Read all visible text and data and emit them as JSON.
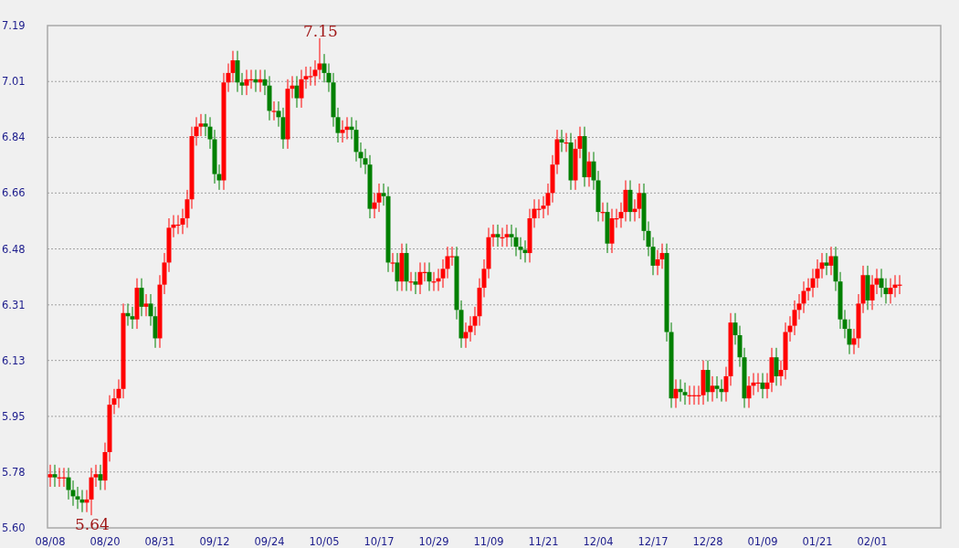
{
  "chart": {
    "chart_data": {
      "type": "candlestick",
      "grid": true,
      "ylim": [
        5.6,
        7.19
      ],
      "yticks": [
        {
          "value": 5.6,
          "label": "5.60"
        },
        {
          "value": 5.777,
          "label": "5.78"
        },
        {
          "value": 5.953,
          "label": "5.95"
        },
        {
          "value": 6.13,
          "label": "6.13"
        },
        {
          "value": 6.306,
          "label": "6.31"
        },
        {
          "value": 6.483,
          "label": "6.48"
        },
        {
          "value": 6.66,
          "label": "6.66"
        },
        {
          "value": 6.836,
          "label": "6.84"
        },
        {
          "value": 7.013,
          "label": "7.01"
        },
        {
          "value": 7.19,
          "label": "7.19"
        }
      ],
      "categories": [
        "08/08",
        null,
        null,
        null,
        null,
        null,
        null,
        null,
        null,
        null,
        null,
        null,
        "08/20",
        null,
        null,
        null,
        null,
        null,
        null,
        null,
        null,
        null,
        null,
        null,
        "08/31",
        null,
        null,
        null,
        null,
        null,
        null,
        null,
        null,
        null,
        null,
        null,
        "09/12",
        null,
        null,
        null,
        null,
        null,
        null,
        null,
        null,
        null,
        null,
        null,
        "09/24",
        null,
        null,
        null,
        null,
        null,
        null,
        null,
        null,
        null,
        null,
        null,
        "10/05",
        null,
        null,
        null,
        null,
        null,
        null,
        null,
        null,
        null,
        null,
        null,
        "10/17",
        null,
        null,
        null,
        null,
        null,
        null,
        null,
        null,
        null,
        null,
        null,
        "10/29",
        null,
        null,
        null,
        null,
        null,
        null,
        null,
        null,
        null,
        null,
        null,
        "11/09",
        null,
        null,
        null,
        null,
        null,
        null,
        null,
        null,
        null,
        null,
        null,
        "11/21",
        null,
        null,
        null,
        null,
        null,
        null,
        null,
        null,
        null,
        null,
        null,
        "12/04",
        null,
        null,
        null,
        null,
        null,
        null,
        null,
        null,
        null,
        null,
        null,
        "12/17",
        null,
        null,
        null,
        null,
        null,
        null,
        null,
        null,
        null,
        null,
        null,
        "12/28",
        null,
        null,
        null,
        null,
        null,
        null,
        null,
        null,
        null,
        null,
        null,
        "01/09",
        null,
        null,
        null,
        null,
        null,
        null,
        null,
        null,
        null,
        null,
        null,
        "01/21",
        null,
        null,
        null,
        null,
        null,
        null,
        null,
        null,
        null,
        null,
        null,
        "02/01",
        null,
        null,
        null,
        null,
        null,
        null
      ],
      "ohlc": [
        [
          5.76,
          5.8,
          5.73,
          5.77
        ],
        [
          5.77,
          5.8,
          5.73,
          5.76
        ],
        [
          5.76,
          5.79,
          5.73,
          5.76
        ],
        [
          5.76,
          5.79,
          5.73,
          5.76
        ],
        [
          5.76,
          5.79,
          5.69,
          5.72
        ],
        [
          5.72,
          5.75,
          5.67,
          5.7
        ],
        [
          5.7,
          5.73,
          5.66,
          5.69
        ],
        [
          5.69,
          5.72,
          5.65,
          5.68
        ],
        [
          5.68,
          5.72,
          5.65,
          5.69
        ],
        [
          5.69,
          5.79,
          5.64,
          5.76
        ],
        [
          5.76,
          5.8,
          5.73,
          5.77
        ],
        [
          5.77,
          5.8,
          5.72,
          5.75
        ],
        [
          5.75,
          5.87,
          5.72,
          5.84
        ],
        [
          5.84,
          6.02,
          5.81,
          5.99
        ],
        [
          5.99,
          6.04,
          5.96,
          6.01
        ],
        [
          6.01,
          6.07,
          5.98,
          6.04
        ],
        [
          6.04,
          6.31,
          6.01,
          6.28
        ],
        [
          6.28,
          6.31,
          6.24,
          6.27
        ],
        [
          6.27,
          6.3,
          6.23,
          6.26
        ],
        [
          6.26,
          6.39,
          6.23,
          6.36
        ],
        [
          6.36,
          6.39,
          6.27,
          6.3
        ],
        [
          6.3,
          6.34,
          6.27,
          6.31
        ],
        [
          6.31,
          6.34,
          6.24,
          6.27
        ],
        [
          6.27,
          6.3,
          6.17,
          6.2
        ],
        [
          6.2,
          6.4,
          6.17,
          6.37
        ],
        [
          6.37,
          6.47,
          6.34,
          6.44
        ],
        [
          6.44,
          6.58,
          6.41,
          6.55
        ],
        [
          6.55,
          6.59,
          6.52,
          6.56
        ],
        [
          6.56,
          6.59,
          6.53,
          6.56
        ],
        [
          6.56,
          6.61,
          6.53,
          6.58
        ],
        [
          6.58,
          6.67,
          6.55,
          6.64
        ],
        [
          6.64,
          6.87,
          6.61,
          6.84
        ],
        [
          6.84,
          6.9,
          6.81,
          6.87
        ],
        [
          6.87,
          6.91,
          6.84,
          6.88
        ],
        [
          6.88,
          6.91,
          6.84,
          6.87
        ],
        [
          6.87,
          6.9,
          6.8,
          6.83
        ],
        [
          6.83,
          6.86,
          6.69,
          6.72
        ],
        [
          6.72,
          6.75,
          6.67,
          6.7
        ],
        [
          6.7,
          7.04,
          6.67,
          7.01
        ],
        [
          7.01,
          7.07,
          6.98,
          7.04
        ],
        [
          7.04,
          7.11,
          7.01,
          7.08
        ],
        [
          7.08,
          7.11,
          6.98,
          7.01
        ],
        [
          7.01,
          7.04,
          6.97,
          7.0
        ],
        [
          7.0,
          7.05,
          6.97,
          7.02
        ],
        [
          7.02,
          7.05,
          6.99,
          7.02
        ],
        [
          7.02,
          7.05,
          6.98,
          7.01
        ],
        [
          7.01,
          7.05,
          6.98,
          7.02
        ],
        [
          7.02,
          7.05,
          6.97,
          7.0
        ],
        [
          7.0,
          7.03,
          6.89,
          6.92
        ],
        [
          6.92,
          6.95,
          6.89,
          6.92
        ],
        [
          6.92,
          6.95,
          6.87,
          6.9
        ],
        [
          6.9,
          6.93,
          6.8,
          6.83
        ],
        [
          6.83,
          7.02,
          6.8,
          6.99
        ],
        [
          6.99,
          7.03,
          6.96,
          7.0
        ],
        [
          7.0,
          7.03,
          6.93,
          6.96
        ],
        [
          6.96,
          7.05,
          6.93,
          7.02
        ],
        [
          7.02,
          7.06,
          6.99,
          7.03
        ],
        [
          7.03,
          7.06,
          7.0,
          7.03
        ],
        [
          7.03,
          7.08,
          7.0,
          7.05
        ],
        [
          7.05,
          7.15,
          7.02,
          7.07
        ],
        [
          7.07,
          7.1,
          7.01,
          7.04
        ],
        [
          7.04,
          7.07,
          6.98,
          7.01
        ],
        [
          7.01,
          7.04,
          6.87,
          6.9
        ],
        [
          6.9,
          6.93,
          6.82,
          6.85
        ],
        [
          6.85,
          6.89,
          6.82,
          6.86
        ],
        [
          6.86,
          6.9,
          6.83,
          6.87
        ],
        [
          6.87,
          6.9,
          6.83,
          6.86
        ],
        [
          6.86,
          6.89,
          6.76,
          6.79
        ],
        [
          6.79,
          6.82,
          6.74,
          6.77
        ],
        [
          6.77,
          6.8,
          6.72,
          6.75
        ],
        [
          6.75,
          6.78,
          6.58,
          6.61
        ],
        [
          6.61,
          6.66,
          6.58,
          6.63
        ],
        [
          6.63,
          6.69,
          6.6,
          6.66
        ],
        [
          6.66,
          6.69,
          6.62,
          6.65
        ],
        [
          6.65,
          6.68,
          6.41,
          6.44
        ],
        [
          6.44,
          6.47,
          6.41,
          6.44
        ],
        [
          6.44,
          6.47,
          6.35,
          6.38
        ],
        [
          6.38,
          6.5,
          6.35,
          6.47
        ],
        [
          6.47,
          6.5,
          6.35,
          6.38
        ],
        [
          6.38,
          6.41,
          6.35,
          6.38
        ],
        [
          6.38,
          6.41,
          6.34,
          6.37
        ],
        [
          6.37,
          6.44,
          6.34,
          6.41
        ],
        [
          6.41,
          6.44,
          6.38,
          6.41
        ],
        [
          6.41,
          6.44,
          6.35,
          6.38
        ],
        [
          6.38,
          6.41,
          6.35,
          6.38
        ],
        [
          6.38,
          6.42,
          6.35,
          6.39
        ],
        [
          6.39,
          6.45,
          6.36,
          6.42
        ],
        [
          6.42,
          6.49,
          6.39,
          6.46
        ],
        [
          6.46,
          6.49,
          6.43,
          6.46
        ],
        [
          6.46,
          6.49,
          6.26,
          6.29
        ],
        [
          6.29,
          6.32,
          6.17,
          6.2
        ],
        [
          6.2,
          6.25,
          6.17,
          6.22
        ],
        [
          6.22,
          6.27,
          6.19,
          6.24
        ],
        [
          6.24,
          6.3,
          6.21,
          6.27
        ],
        [
          6.27,
          6.39,
          6.24,
          6.36
        ],
        [
          6.36,
          6.45,
          6.33,
          6.42
        ],
        [
          6.42,
          6.55,
          6.39,
          6.52
        ],
        [
          6.52,
          6.56,
          6.49,
          6.53
        ],
        [
          6.53,
          6.56,
          6.49,
          6.52
        ],
        [
          6.52,
          6.55,
          6.49,
          6.52
        ],
        [
          6.52,
          6.56,
          6.49,
          6.53
        ],
        [
          6.53,
          6.56,
          6.49,
          6.52
        ],
        [
          6.52,
          6.55,
          6.46,
          6.49
        ],
        [
          6.49,
          6.52,
          6.45,
          6.48
        ],
        [
          6.48,
          6.51,
          6.44,
          6.47
        ],
        [
          6.47,
          6.61,
          6.44,
          6.58
        ],
        [
          6.58,
          6.64,
          6.55,
          6.61
        ],
        [
          6.61,
          6.64,
          6.58,
          6.61
        ],
        [
          6.61,
          6.65,
          6.58,
          6.62
        ],
        [
          6.62,
          6.69,
          6.59,
          6.66
        ],
        [
          6.66,
          6.78,
          6.63,
          6.75
        ],
        [
          6.75,
          6.86,
          6.72,
          6.83
        ],
        [
          6.83,
          6.86,
          6.79,
          6.82
        ],
        [
          6.82,
          6.85,
          6.79,
          6.82
        ],
        [
          6.82,
          6.85,
          6.67,
          6.7
        ],
        [
          6.7,
          6.83,
          6.67,
          6.8
        ],
        [
          6.8,
          6.87,
          6.77,
          6.84
        ],
        [
          6.84,
          6.87,
          6.68,
          6.71
        ],
        [
          6.71,
          6.79,
          6.68,
          6.76
        ],
        [
          6.76,
          6.79,
          6.67,
          6.7
        ],
        [
          6.7,
          6.73,
          6.57,
          6.6
        ],
        [
          6.6,
          6.63,
          6.57,
          6.6
        ],
        [
          6.6,
          6.63,
          6.47,
          6.5
        ],
        [
          6.5,
          6.61,
          6.47,
          6.58
        ],
        [
          6.58,
          6.61,
          6.55,
          6.58
        ],
        [
          6.58,
          6.63,
          6.55,
          6.6
        ],
        [
          6.6,
          6.7,
          6.57,
          6.67
        ],
        [
          6.67,
          6.7,
          6.57,
          6.6
        ],
        [
          6.6,
          6.64,
          6.57,
          6.61
        ],
        [
          6.61,
          6.69,
          6.58,
          6.66
        ],
        [
          6.66,
          6.69,
          6.51,
          6.54
        ],
        [
          6.54,
          6.57,
          6.46,
          6.49
        ],
        [
          6.49,
          6.52,
          6.4,
          6.43
        ],
        [
          6.43,
          6.48,
          6.4,
          6.45
        ],
        [
          6.45,
          6.5,
          6.42,
          6.47
        ],
        [
          6.47,
          6.5,
          6.19,
          6.22
        ],
        [
          6.22,
          6.25,
          5.98,
          6.01
        ],
        [
          6.01,
          6.07,
          5.98,
          6.04
        ],
        [
          6.04,
          6.07,
          6.0,
          6.03
        ],
        [
          6.03,
          6.06,
          5.99,
          6.02
        ],
        [
          6.02,
          6.05,
          5.99,
          6.02
        ],
        [
          6.02,
          6.05,
          5.99,
          6.02
        ],
        [
          6.02,
          6.05,
          5.99,
          6.02
        ],
        [
          6.02,
          6.13,
          5.99,
          6.1
        ],
        [
          6.1,
          6.13,
          6.0,
          6.03
        ],
        [
          6.03,
          6.08,
          6.0,
          6.05
        ],
        [
          6.05,
          6.08,
          6.01,
          6.04
        ],
        [
          6.04,
          6.07,
          6.0,
          6.03
        ],
        [
          6.03,
          6.11,
          6.0,
          6.08
        ],
        [
          6.08,
          6.28,
          6.05,
          6.25
        ],
        [
          6.25,
          6.28,
          6.18,
          6.21
        ],
        [
          6.21,
          6.24,
          6.11,
          6.14
        ],
        [
          6.14,
          6.17,
          5.98,
          6.01
        ],
        [
          6.01,
          6.08,
          5.98,
          6.05
        ],
        [
          6.05,
          6.09,
          6.02,
          6.06
        ],
        [
          6.06,
          6.09,
          6.03,
          6.06
        ],
        [
          6.06,
          6.09,
          6.01,
          6.04
        ],
        [
          6.04,
          6.09,
          6.01,
          6.06
        ],
        [
          6.06,
          6.17,
          6.03,
          6.14
        ],
        [
          6.14,
          6.17,
          6.05,
          6.08
        ],
        [
          6.08,
          6.13,
          6.05,
          6.1
        ],
        [
          6.1,
          6.25,
          6.07,
          6.22
        ],
        [
          6.22,
          6.27,
          6.19,
          6.24
        ],
        [
          6.24,
          6.32,
          6.21,
          6.29
        ],
        [
          6.29,
          6.34,
          6.26,
          6.31
        ],
        [
          6.31,
          6.38,
          6.28,
          6.35
        ],
        [
          6.35,
          6.39,
          6.32,
          6.36
        ],
        [
          6.36,
          6.42,
          6.33,
          6.39
        ],
        [
          6.39,
          6.45,
          6.36,
          6.42
        ],
        [
          6.42,
          6.47,
          6.39,
          6.44
        ],
        [
          6.44,
          6.47,
          6.4,
          6.43
        ],
        [
          6.43,
          6.49,
          6.4,
          6.46
        ],
        [
          6.46,
          6.49,
          6.35,
          6.38
        ],
        [
          6.38,
          6.41,
          6.23,
          6.26
        ],
        [
          6.26,
          6.29,
          6.2,
          6.23
        ],
        [
          6.23,
          6.26,
          6.15,
          6.18
        ],
        [
          6.18,
          6.23,
          6.15,
          6.2
        ],
        [
          6.2,
          6.34,
          6.17,
          6.31
        ],
        [
          6.31,
          6.43,
          6.28,
          6.4
        ],
        [
          6.4,
          6.43,
          6.29,
          6.32
        ],
        [
          6.32,
          6.4,
          6.29,
          6.37
        ],
        [
          6.37,
          6.42,
          6.34,
          6.39
        ],
        [
          6.39,
          6.42,
          6.33,
          6.36
        ],
        [
          6.36,
          6.39,
          6.31,
          6.34
        ],
        [
          6.34,
          6.39,
          6.31,
          6.36
        ],
        [
          6.36,
          6.4,
          6.33,
          6.37
        ],
        [
          6.37,
          6.4,
          6.34,
          6.37
        ]
      ],
      "annotations": [
        {
          "text": "7.15",
          "y": 7.15
        },
        {
          "text": "5.64",
          "y": 5.64
        }
      ]
    }
  }
}
